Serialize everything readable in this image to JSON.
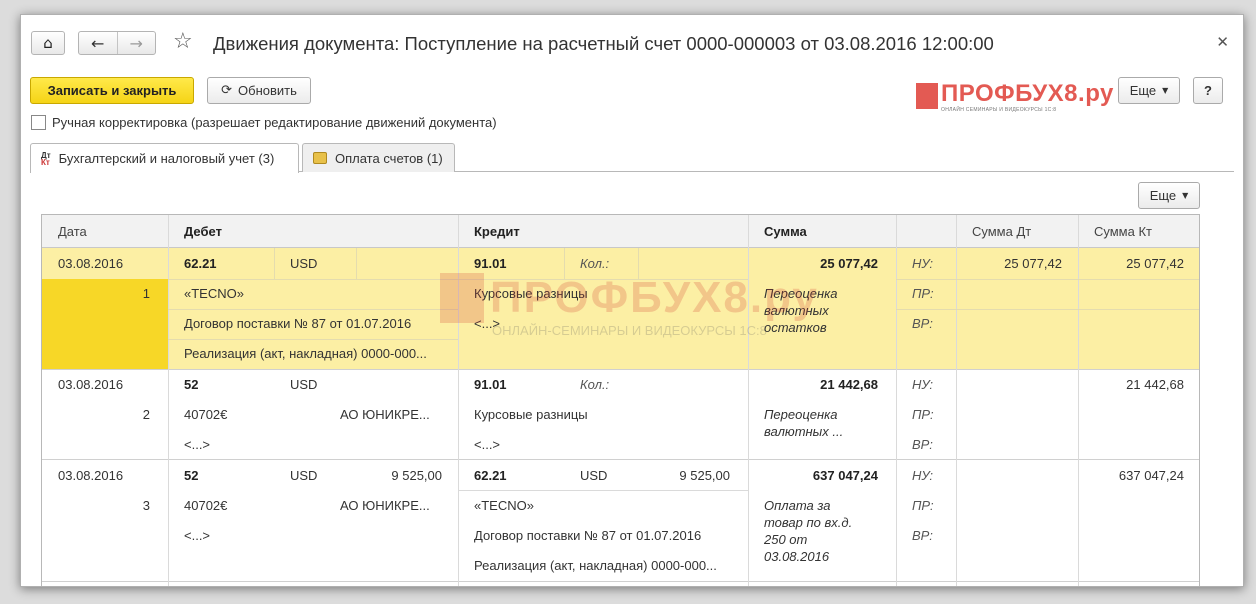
{
  "window": {
    "title": "Движения документа: Поступление на расчетный счет 0000-000003 от 03.08.2016 12:00:00",
    "home_icon": "home-icon",
    "back_icon": "arrow-left-icon",
    "forward_icon": "arrow-right-icon",
    "star_icon": "star-icon",
    "close_icon": "close-icon"
  },
  "toolbar": {
    "save_close_label": "Записать и закрыть",
    "refresh_label": "Обновить",
    "more_label": "Еще",
    "help_label": "?"
  },
  "logo": {
    "text": "ПРОФБУХ8.ру",
    "subtitle": "ОНЛАЙН СЕМИНАРЫ И ВИДЕОКУРСЫ 1С:8"
  },
  "manual_edit": {
    "label": "Ручная корректировка (разрешает редактирование движений документа)",
    "checked": false
  },
  "tabs": [
    {
      "label": "Бухгалтерский и налоговый учет (3)",
      "icon": "dt-kt-icon",
      "active": true
    },
    {
      "label": "Оплата счетов (1)",
      "icon": "coin-icon",
      "active": false
    }
  ],
  "table": {
    "more_label": "Еще",
    "headers": {
      "date": "Дата",
      "debit": "Дебет",
      "credit": "Кредит",
      "sum": "Сумма",
      "sum_dt": "Сумма Дт",
      "sum_kt": "Сумма Кт"
    },
    "watermark": {
      "text": "ПРОФБУХ8.ру",
      "subtitle": "ОНЛАЙН-СЕМИНАРЫ И ВИДЕОКУРСЫ 1С:8"
    },
    "rows": [
      {
        "date": "03.08.2016",
        "num": "1",
        "debit_account": "62.21",
        "debit_currency": "USD",
        "debit_amount": "",
        "debit_sub1": "«TECNO»",
        "debit_sub2": "Договор поставки № 87 от 01.07.2016",
        "debit_sub3": "Реализация (акт, накладная) 0000-000...",
        "credit_account": "91.01",
        "credit_qty_label": "Кол.:",
        "credit_currency": "",
        "credit_amount": "",
        "credit_sub1": "Курсовые разницы",
        "credit_sub2": "<...>",
        "credit_sub3": "",
        "sum": "25 077,42",
        "content": "Переоценка валютных остатков",
        "nu_label": "НУ:",
        "pr_label": "ПР:",
        "vr_label": "ВР:",
        "sum_dt": "25 077,42",
        "sum_kt": "25 077,42"
      },
      {
        "date": "03.08.2016",
        "num": "2",
        "debit_account": "52",
        "debit_currency": "USD",
        "debit_amount": "",
        "debit_sub1": "40702€",
        "debit_sub1b": "АО ЮНИКРЕ...",
        "debit_sub2": "<...>",
        "debit_sub3": "",
        "credit_account": "91.01",
        "credit_qty_label": "Кол.:",
        "credit_currency": "",
        "credit_amount": "",
        "credit_sub1": "Курсовые разницы",
        "credit_sub2": "<...>",
        "credit_sub3": "",
        "sum": "21 442,68",
        "content": "Переоценка валютных ...",
        "nu_label": "НУ:",
        "pr_label": "ПР:",
        "vr_label": "ВР:",
        "sum_dt": "",
        "sum_kt": "21 442,68"
      },
      {
        "date": "03.08.2016",
        "num": "3",
        "debit_account": "52",
        "debit_currency": "USD",
        "debit_amount": "9 525,00",
        "debit_sub1": "40702€",
        "debit_sub1b": "АО ЮНИКРЕ...",
        "debit_sub2": "<...>",
        "debit_sub3": "",
        "credit_account": "62.21",
        "credit_qty_label": "",
        "credit_currency": "USD",
        "credit_amount": "9 525,00",
        "credit_sub1": "«TECNO»",
        "credit_sub2": "Договор поставки № 87 от 01.07.2016",
        "credit_sub3": "Реализация (акт, накладная) 0000-000...",
        "sum": "637 047,24",
        "content": "Оплата за товар по вх.д. 250 от 03.08.2016",
        "nu_label": "НУ:",
        "pr_label": "ПР:",
        "vr_label": "ВР:",
        "sum_dt": "",
        "sum_kt": "637 047,24"
      }
    ]
  },
  "colors": {
    "primary_button": "#f5d416",
    "selected_row": "#fcefa4",
    "selected_num": "#f7d727",
    "logo": "#e35a53"
  }
}
